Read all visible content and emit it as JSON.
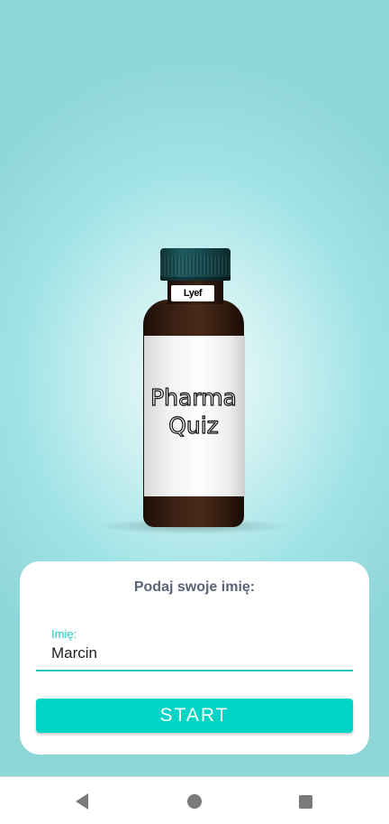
{
  "hero": {
    "bottle_neck_label": "Lyef",
    "bottle_title_line1": "Pharma",
    "bottle_title_line2": "Quiz"
  },
  "form": {
    "prompt": "Podaj swoje imię:",
    "name_label": "Imię:",
    "name_value": "Marcin",
    "start_label": "START"
  },
  "navbar": {
    "back_icon": "back-triangle",
    "home_icon": "home-circle",
    "recent_icon": "recent-square"
  },
  "colors": {
    "accent": "#00d4c4",
    "prompt_text": "#5a6378",
    "background": "#9fe3e6"
  }
}
